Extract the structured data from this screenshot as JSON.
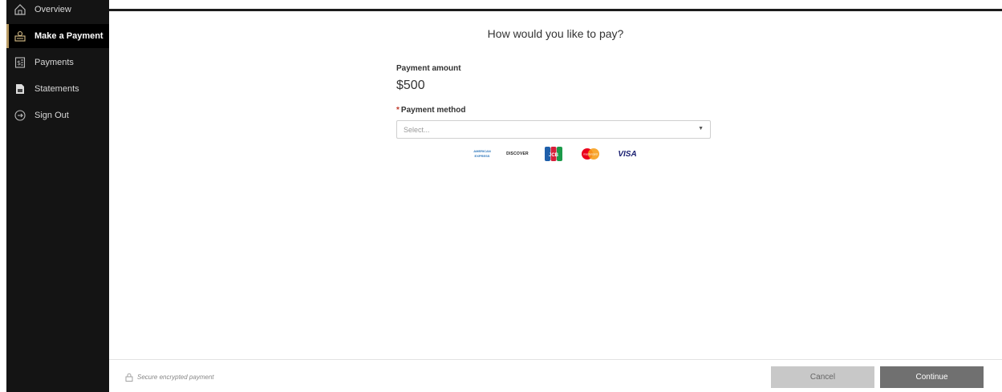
{
  "sidebar": {
    "items": [
      {
        "label": "Overview",
        "icon": "home-icon"
      },
      {
        "label": "Make a Payment",
        "icon": "payment-icon"
      },
      {
        "label": "Payments",
        "icon": "bill-icon"
      },
      {
        "label": "Statements",
        "icon": "statement-icon"
      },
      {
        "label": "Sign Out",
        "icon": "signout-icon"
      }
    ],
    "accent_color": "#b79a63"
  },
  "main": {
    "title": "How would you like to pay?",
    "amount_label": "Payment amount",
    "amount_value": "$500",
    "method_required_mark": "*",
    "method_label": "Payment method",
    "method_placeholder": "Select...",
    "cards": {
      "amex_line1": "AMERICAN",
      "amex_line2": "EXPRESS",
      "discover": "DISCOVER",
      "jcb": "JCB",
      "mastercard": "mastercard",
      "visa": "VISA"
    }
  },
  "footer": {
    "secure_text": "Secure encrypted payment",
    "cancel_label": "Cancel",
    "continue_label": "Continue"
  }
}
